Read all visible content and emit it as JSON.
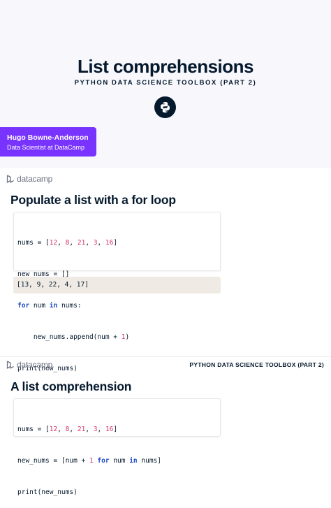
{
  "cover": {
    "title": "List comprehensions",
    "subtitle": "PYTHON DATA SCIENCE TOOLBOX (PART 2)",
    "author_name": "Hugo Bowne-Anderson",
    "author_role": "Data Scientist at DataCamp"
  },
  "brand": {
    "logo_text": "datacamp"
  },
  "slide2": {
    "heading": "Populate a list with a for loop",
    "code": {
      "l1": {
        "a": "nums = [",
        "n1": "12",
        "s1": ", ",
        "n2": "8",
        "s2": ", ",
        "n3": "21",
        "s3": ", ",
        "n4": "3",
        "s4": ", ",
        "n5": "16",
        "end": "]"
      },
      "l2": "new_nums = []",
      "l3": {
        "kw1": "for",
        "mid": " num ",
        "kw2": "in",
        "end": " nums:"
      },
      "l4": {
        "a": "    new_nums.append(num + ",
        "n": "1",
        "end": ")"
      },
      "l5": "print(new_nums)"
    },
    "output": "[13, 9, 22, 4, 17]"
  },
  "slide3": {
    "footer": "PYTHON DATA SCIENCE TOOLBOX (PART 2)",
    "heading": "A list comprehension",
    "code": {
      "l1": {
        "a": "nums = [",
        "n1": "12",
        "s1": ", ",
        "n2": "8",
        "s2": ", ",
        "n3": "21",
        "s3": ", ",
        "n4": "3",
        "s4": ", ",
        "n5": "16",
        "end": "]"
      },
      "l2": {
        "a": "new_nums = [num + ",
        "n": "1",
        "sp": " ",
        "kw1": "for",
        "mid": " num ",
        "kw2": "in",
        "end": " nums]"
      },
      "l3": "print(new_nums)"
    }
  },
  "colors": {
    "navy": "#05192d",
    "purple": "#7933ff",
    "keyword": "#1f4bc5",
    "number": "#d6336c",
    "output_bg": "#efebe4"
  },
  "icons": [
    "python-logo-icon",
    "datacamp-logo-icon"
  ]
}
